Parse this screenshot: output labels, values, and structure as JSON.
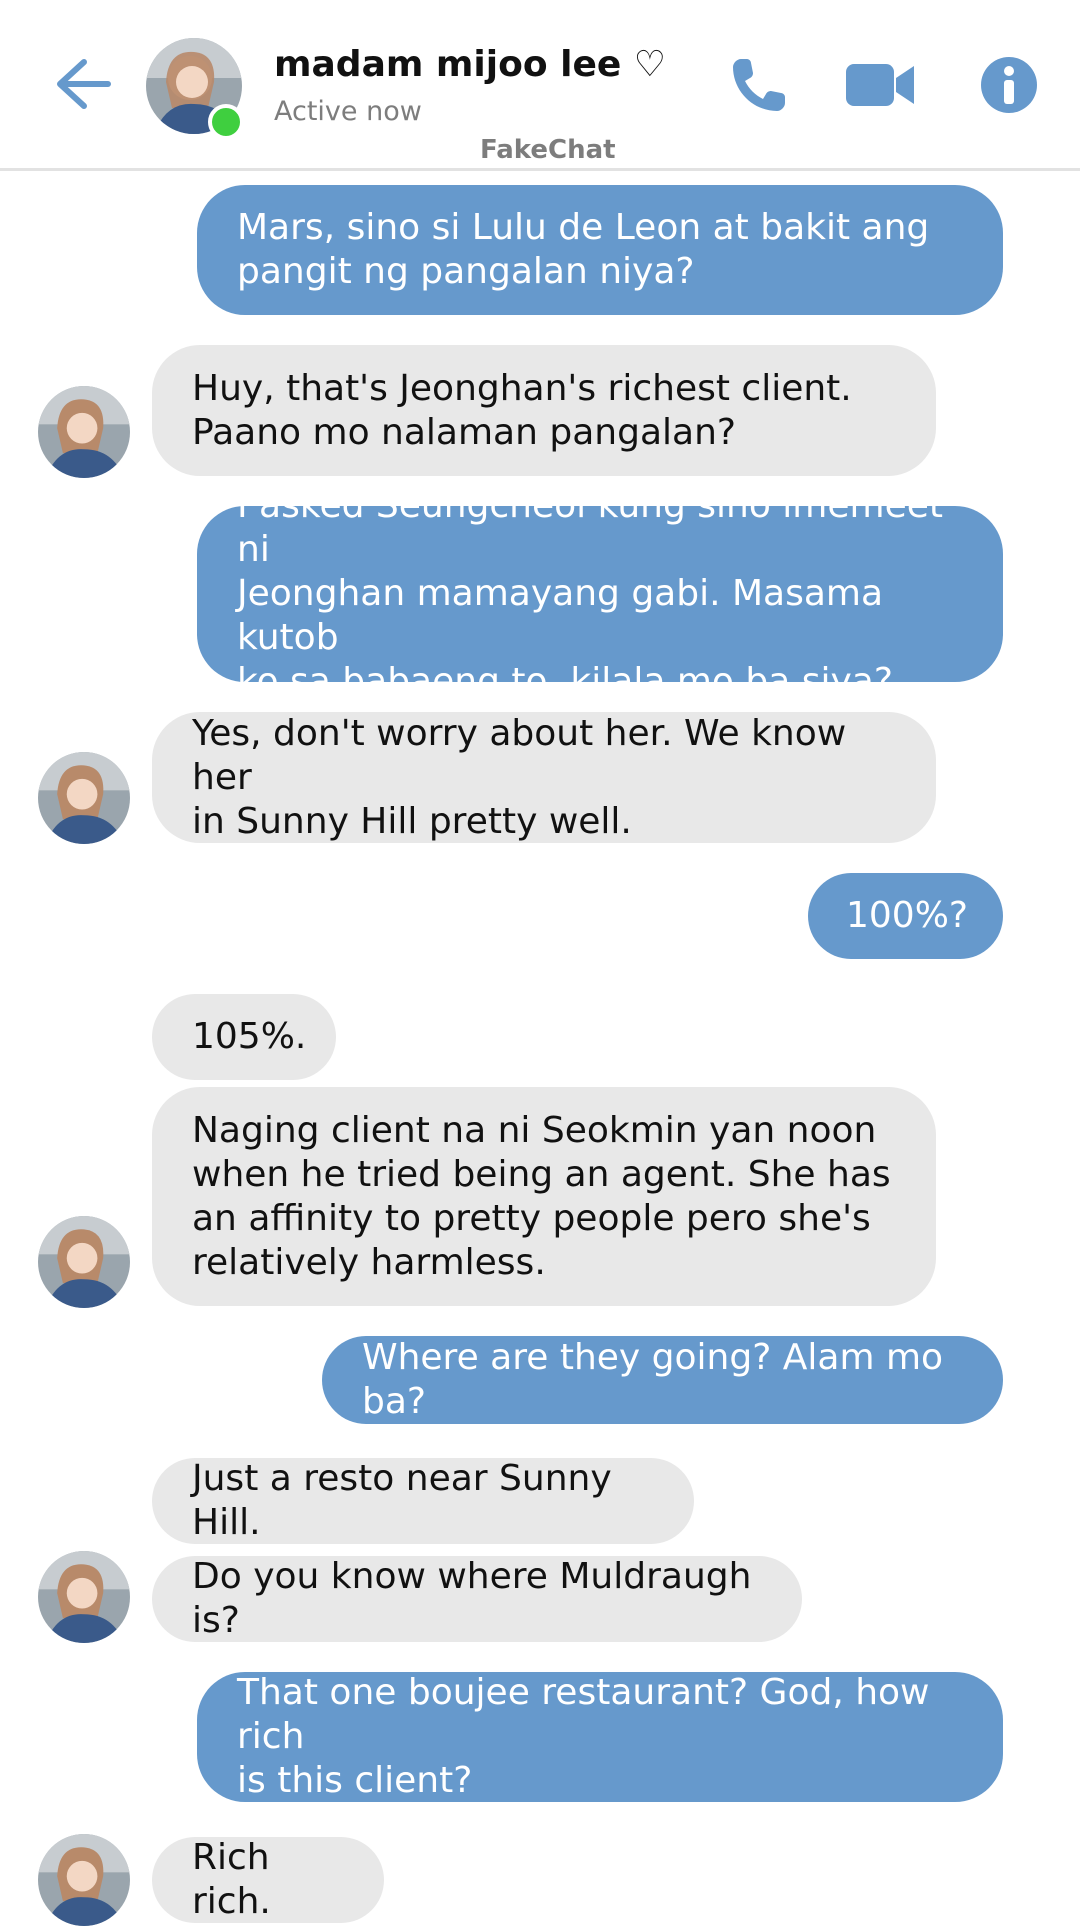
{
  "header": {
    "contact_name": "madam mijoo lee ♡",
    "status": "Active now",
    "app_label": "FakeChat"
  },
  "colors": {
    "accent": "#6699cc",
    "outgoing_bubble": "#6699cc",
    "incoming_bubble": "#e8e8e8",
    "online": "#3fcf3f"
  },
  "icons": [
    "back-arrow-icon",
    "phone-icon",
    "video-camera-icon",
    "info-icon"
  ],
  "messages": [
    {
      "from": "me",
      "text": "Mars, sino si Lulu de Leon at bakit ang\npangit ng pangalan niya?"
    },
    {
      "from": "them",
      "text": "Huy, that's Jeonghan's richest client.\nPaano mo nalaman pangalan?"
    },
    {
      "from": "me",
      "text": "I asked Seungcheol kung sino imemeet ni\nJeonghan mamayang gabi. Masama kutob\nko sa babaeng to, kilala mo ba siya?"
    },
    {
      "from": "them",
      "text": "Yes, don't worry about her. We know her\nin Sunny Hill pretty well."
    },
    {
      "from": "me",
      "text": "100%?"
    },
    {
      "from": "them",
      "text": "105%."
    },
    {
      "from": "them",
      "text": "Naging client na ni Seokmin yan noon\nwhen he tried being an agent. She has\nan affinity to pretty people pero she's\nrelatively harmless."
    },
    {
      "from": "me",
      "text": "Where are they going? Alam mo ba?"
    },
    {
      "from": "them",
      "text": "Just a resto near Sunny Hill."
    },
    {
      "from": "them",
      "text": "Do you know where Muldraugh is?"
    },
    {
      "from": "me",
      "text": "That one boujee restaurant? God, how rich\nis this client?"
    },
    {
      "from": "them",
      "text": "Rich rich."
    }
  ]
}
